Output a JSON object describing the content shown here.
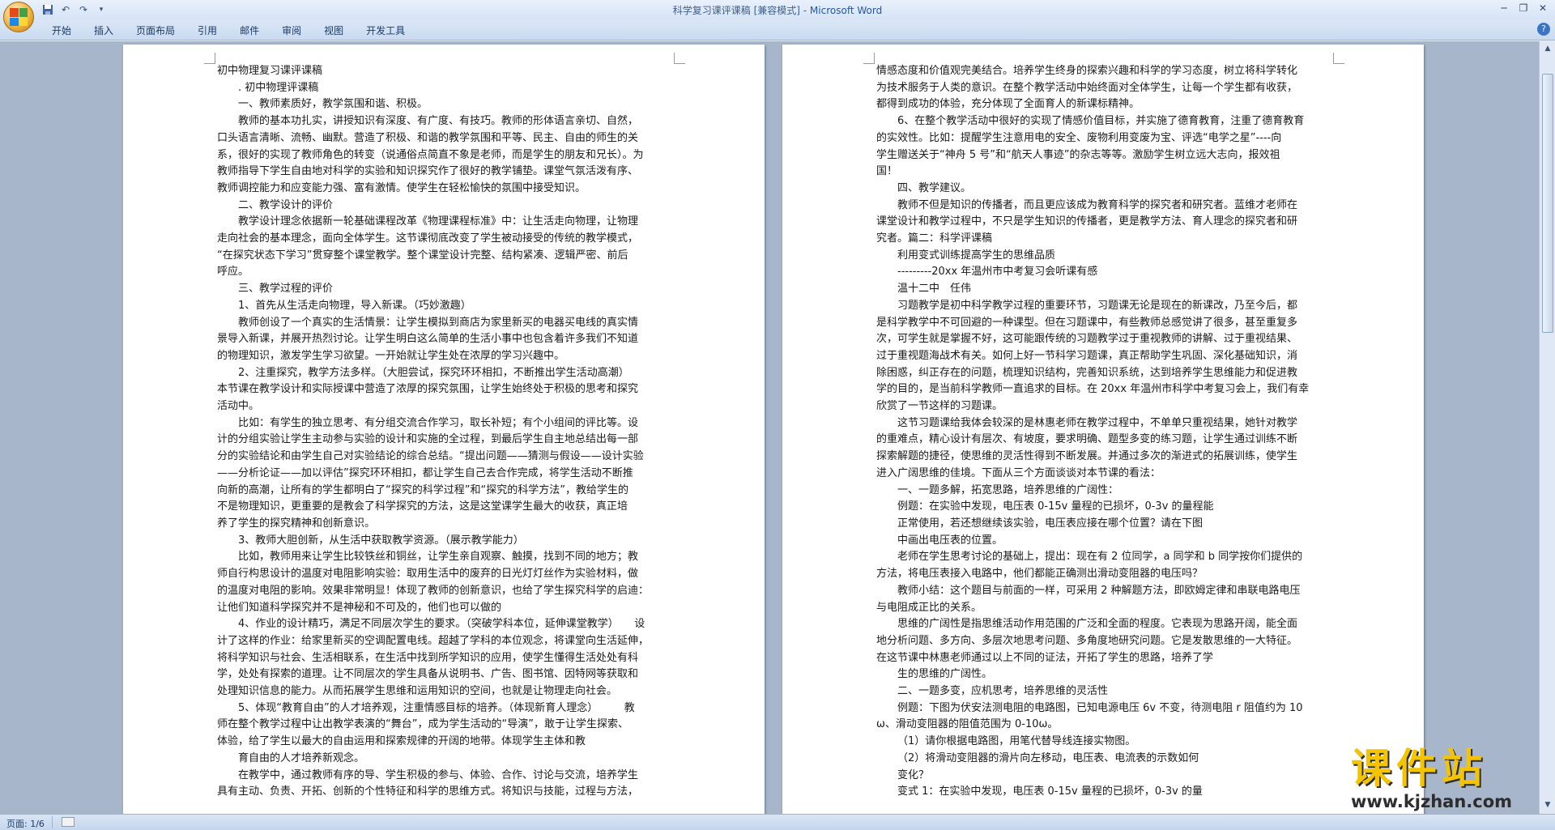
{
  "window": {
    "title": "科学复习课评课稿 [兼容模式] - ",
    "app_name": "Microsoft Word"
  },
  "quick_access": {
    "save_icon": "save-icon",
    "undo_icon": "undo-icon",
    "redo_icon": "redo-icon",
    "customize_icon": "customize-icon"
  },
  "ribbon_tabs": [
    "开始",
    "插入",
    "页面布局",
    "引用",
    "邮件",
    "审阅",
    "视图",
    "开发工具"
  ],
  "page1_lines": [
    {
      "t": "初中物理复习课评课稿",
      "i": false
    },
    {
      "t": ". 初中物理评课稿",
      "i": true
    },
    {
      "t": "一、教师素质好，教学氛围和谐、积极。",
      "i": true
    },
    {
      "t": "教师的基本功扎实，讲授知识有深度、有广度、有技巧。教师的形体语言亲切、自然，",
      "i": true
    },
    {
      "t": "口头语言清晰、流畅、幽默。营造了积极、和谐的教学氛围和平等、民主、自由的师生的关",
      "i": false
    },
    {
      "t": "系，很好的实现了教师角色的转变（说通俗点简直不象是老师，而是学生的朋友和兄长）。为",
      "i": false
    },
    {
      "t": "教师指导下学生自由地对科学的实验和知识探究作了很好的教学铺垫。课堂气氛活泼有序、",
      "i": false
    },
    {
      "t": "教师调控能力和应变能力强、富有激情。使学生在轻松愉快的氛围中接受知识。",
      "i": false
    },
    {
      "t": "二、教学设计的评价",
      "i": true
    },
    {
      "t": "教学设计理念依据新一轮基础课程改革《物理课程标准》中：让生活走向物理，让物理",
      "i": true
    },
    {
      "t": "走向社会的基本理念，面向全体学生。这节课彻底改变了学生被动接受的传统的教学模式，",
      "i": false
    },
    {
      "t": "“在探究状态下学习”贯穿整个课堂教学。整个课堂设计完整、结构紧凑、逻辑严密、前后",
      "i": false
    },
    {
      "t": "呼应。",
      "i": false
    },
    {
      "t": "三、教学过程的评价",
      "i": true
    },
    {
      "t": "1、首先从生活走向物理，导入新课。（巧妙激趣）",
      "i": true
    },
    {
      "t": "教师创设了一个真实的生活情景：让学生模拟到商店为家里新买的电器买电线的真实情",
      "i": true
    },
    {
      "t": "景导入新课，并展开热烈讨论。让学生明白这么简单的生活小事中也包含着许多我们不知道",
      "i": false
    },
    {
      "t": "的物理知识，激发学生学习欲望。一开始就让学生处在浓厚的学习兴趣中。",
      "i": false
    },
    {
      "t": "2、注重探究，教学方法多样。（大胆尝试，探究环环相扣，不断推出学生活动高潮）",
      "i": true
    },
    {
      "t": "本节课在教学设计和实际授课中营造了浓厚的探究氛围，让学生始终处于积极的思考和探究",
      "i": false
    },
    {
      "t": "活动中。",
      "i": false
    },
    {
      "t": "比如：有学生的独立思考、有分组交流合作学习，取长补短；有个小组间的评比等。设",
      "i": true
    },
    {
      "t": "计的分组实验让学生主动参与实验的设计和实施的全过程，到最后学生自主地总结出每一部",
      "i": false
    },
    {
      "t": "分的实验结论和由学生自己对实验结论的综合总结。“提出问题——猜测与假设——设计实验",
      "i": false
    },
    {
      "t": "——分析论证——加以评估”探究环环相扣，都让学生自己去合作完成，将学生活动不断推",
      "i": false
    },
    {
      "t": "向新的高潮，让所有的学生都明白了“探究的科学过程”和“探究的科学方法”，教给学生的",
      "i": false
    },
    {
      "t": "不是物理知识，更重要的是教会了科学探究的方法，这是这堂课学生最大的收获，真正培",
      "i": false
    },
    {
      "t": "养了学生的探究精神和创新意识。",
      "i": false
    },
    {
      "t": "3、教师大胆创新，从生活中获取教学资源。（展示教学能力）",
      "i": true
    },
    {
      "t": "比如，教师用来让学生比较铁丝和铜丝，让学生亲自观察、触摸，找到不同的地方；教",
      "i": true
    },
    {
      "t": "师自行构思设计的温度对电阻影响实验：取用生活中的废弃的日光灯灯丝作为实验材料，做",
      "i": false
    },
    {
      "t": "的温度对电阻的影响。效果非常明显！体现了教师的创新意识，也给了学生探究科学的启迪：",
      "i": false
    },
    {
      "t": "让他们知道科学探究并不是神秘和不可及的，他们也可以做的",
      "i": false
    },
    {
      "t": "4、作业的设计精巧，满足不同层次学生的要求。（突破学科本位，延伸课堂教学）　　设",
      "i": true
    },
    {
      "t": "计了这样的作业：给家里新买的空调配置电线。超越了学科的本位观念，将课堂向生活延伸，",
      "i": false
    },
    {
      "t": "将科学知识与社会、生活相联系，在生活中找到所学知识的应用，使学生懂得生活处处有科",
      "i": false
    },
    {
      "t": "学，处处有探索的道理。让不同层次的学生具备从说明书、广告、图书馆、因特网等获取和",
      "i": false
    },
    {
      "t": "处理知识信息的能力。从而拓展学生思维和运用知识的空间，也就是让物理走向社会。",
      "i": false
    },
    {
      "t": "5、体现“教育自由”的人才培养观，注重情感目标的培养。（体现新育人理念）　　　教",
      "i": true
    },
    {
      "t": "师在整个教学过程中让出教学表演的“舞台”，成为学生活动的“导演”，敢于让学生探索、",
      "i": false
    },
    {
      "t": "体验，给了学生以最大的自由运用和探索规律的开阔的地带。体现学生主体和教",
      "i": false
    },
    {
      "t": "育自由的人才培养新观念。",
      "i": true
    },
    {
      "t": "在教学中，通过教师有序的导、学生积极的参与、体验、合作、讨论与交流，培养学生",
      "i": true
    },
    {
      "t": "具有主动、负责、开拓、创新的个性特征和科学的思维方式。将知识与技能，过程与方法，",
      "i": false
    }
  ],
  "page2_lines": [
    {
      "t": "情感态度和价值观完美结合。培养学生终身的探索兴趣和科学的学习态度，树立将科学转化",
      "i": false
    },
    {
      "t": "为技术服务于人类的意识。在整个教学活动中始终面对全体学生，让每一个学生都有收获，",
      "i": false
    },
    {
      "t": "都得到成功的体验，充分体现了全面育人的新课标精神。",
      "i": false
    },
    {
      "t": "6、在整个教学活动中很好的实现了情感价值目标，并实施了德育教育，注重了德育教育",
      "i": true
    },
    {
      "t": "的实效性。比如：提醒学生注意用电的安全、废物利用变废为宝、评选“电学之星”----向",
      "i": false
    },
    {
      "t": "学生赠送关于“神舟 5 号”和“航天人事迹”的杂志等等。激励学生树立远大志向，报效祖",
      "i": false
    },
    {
      "t": "国！",
      "i": false
    },
    {
      "t": "四、教学建议。",
      "i": true
    },
    {
      "t": "教师不但是知识的传播者，而且更应该成为教育科学的探究者和研究者。蓝维才老师在",
      "i": true
    },
    {
      "t": "课堂设计和教学过程中，不只是学生知识的传播者，更是教学方法、育人理念的探究者和研",
      "i": false
    },
    {
      "t": "究者。篇二：科学评课稿",
      "i": false
    },
    {
      "t": "利用变式训练提高学生的思维品质",
      "i": true
    },
    {
      "t": "---------20xx 年温州市中考复习会听课有感",
      "i": true
    },
    {
      "t": "温十二中　任伟",
      "i": true
    },
    {
      "t": "习题教学是初中科学教学过程的重要环节，习题课无论是现在的新课改，乃至今后，都",
      "i": true
    },
    {
      "t": "是科学教学中不可回避的一种课型。但在习题课中，有些教师总感觉讲了很多，甚至重复多",
      "i": false
    },
    {
      "t": "次，可学生就是掌握不好，这可能跟传统的习题教学过于重视教师的讲解、过于重视结果、",
      "i": false
    },
    {
      "t": "过于重视题海战术有关。如何上好一节科学习题课，真正帮助学生巩固、深化基础知识，消",
      "i": false
    },
    {
      "t": "除困惑，纠正存在的问题，梳理知识结构，完善知识系统，达到培养学生思维能力和促进教",
      "i": false
    },
    {
      "t": "学的目的，是当前科学教师一直追求的目标。在 20xx 年温州市科学中考复习会上，我们有幸",
      "i": false
    },
    {
      "t": "欣赏了一节这样的习题课。",
      "i": false
    },
    {
      "t": "这节习题课给我体会较深的是林惠老师在教学过程中，不单单只重视结果，她针对教学",
      "i": true
    },
    {
      "t": "的重难点，精心设计有层次、有坡度，要求明确、题型多变的练习题，让学生通过训练不断",
      "i": false
    },
    {
      "t": "探索解题的捷径，使思维的灵活性得到不断发展。并通过多次的渐进式的拓展训练，使学生",
      "i": false
    },
    {
      "t": "进入广阔思维的佳境。下面从三个方面谈谈对本节课的看法：",
      "i": false
    },
    {
      "t": "一、一题多解，拓宽思路，培养思维的广阔性：",
      "i": true
    },
    {
      "t": "例题：在实验中发现，电压表 0-15v 量程的已损坏，0-3v 的量程能",
      "i": true
    },
    {
      "t": "正常使用，若还想继续该实验，电压表应接在哪个位置？请在下图",
      "i": true
    },
    {
      "t": "中画出电压表的位置。",
      "i": true
    },
    {
      "t": "老师在学生思考讨论的基础上，提出：现在有 2 位同学，a 同学和 b 同学按你们提供的",
      "i": true
    },
    {
      "t": "方法，将电压表接入电路中，他们都能正确测出滑动变阻器的电压吗？",
      "i": false
    },
    {
      "t": "教师小结：这个题目与前面的一样，可采用 2 种解题方法，即欧姆定律和串联电路电压",
      "i": true
    },
    {
      "t": "与电阻成正比的关系。",
      "i": false
    },
    {
      "t": "思维的广阔性是指思维活动作用范围的广泛和全面的程度。它表现为思路开阔，能全面",
      "i": true
    },
    {
      "t": "地分析问题、多方向、多层次地思考问题、多角度地研究问题。它是发散思维的一大特征。",
      "i": false
    },
    {
      "t": "在这节课中林惠老师通过以上不同的证法，开拓了学生的思路，培养了学",
      "i": false
    },
    {
      "t": "生的思维的广阔性。",
      "i": true
    },
    {
      "t": "二、一题多变，应机思考，培养思维的灵活性",
      "i": true
    },
    {
      "t": "例题：下图为伏安法测电阻的电路图，已知电源电压 6v 不变，待测电阻 r 阻值约为 10",
      "i": true
    },
    {
      "t": "ω、滑动变阻器的阻值范围为 0-10ω。",
      "i": false
    },
    {
      "t": "（1）请你根据电路图，用笔代替导线连接实物图。",
      "i": true
    },
    {
      "t": "（2）将滑动变阻器的滑片向左移动，电压表、电流表的示数如何",
      "i": true
    },
    {
      "t": "变化？",
      "i": true
    },
    {
      "t": "变式 1：在实验中发现，电压表 0-15v 量程的已损坏，0-3v 的量",
      "i": true
    }
  ],
  "status": {
    "page_indicator": "页面: 1/6"
  },
  "watermark": {
    "brand": "课件站",
    "url": "www.kjzhan.com"
  }
}
